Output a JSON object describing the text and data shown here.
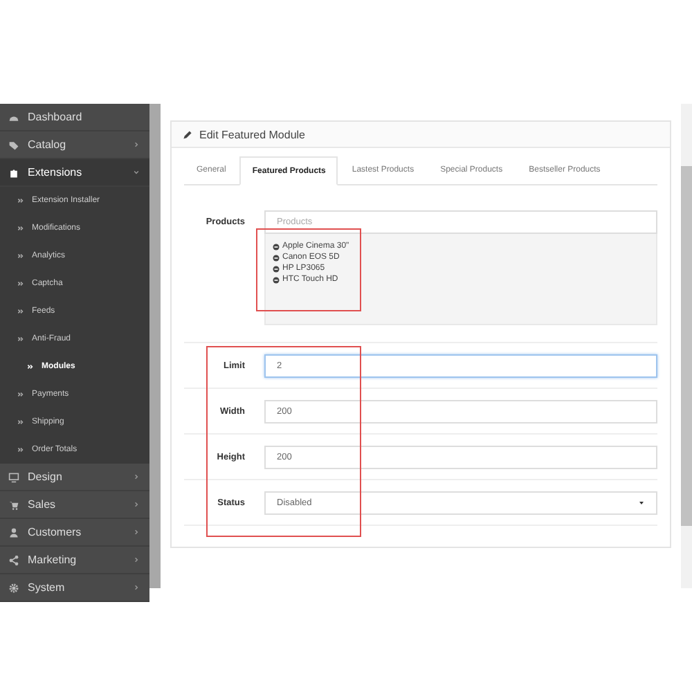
{
  "sidebar": {
    "items": [
      {
        "label": "Dashboard"
      },
      {
        "label": "Catalog",
        "expanded": false
      },
      {
        "label": "Extensions",
        "expanded": true,
        "children": [
          {
            "label": "Extension Installer",
            "selected": false
          },
          {
            "label": "Modifications",
            "selected": false
          },
          {
            "label": "Analytics",
            "selected": false
          },
          {
            "label": "Captcha",
            "selected": false
          },
          {
            "label": "Feeds",
            "selected": false
          },
          {
            "label": "Anti-Fraud",
            "selected": false
          },
          {
            "label": "Modules",
            "selected": true
          },
          {
            "label": "Payments",
            "selected": false
          },
          {
            "label": "Shipping",
            "selected": false
          },
          {
            "label": "Order Totals",
            "selected": false
          }
        ]
      },
      {
        "label": "Design",
        "expanded": false
      },
      {
        "label": "Sales",
        "expanded": false
      },
      {
        "label": "Customers",
        "expanded": false
      },
      {
        "label": "Marketing",
        "expanded": false
      },
      {
        "label": "System",
        "expanded": false
      }
    ]
  },
  "panel": {
    "title": "Edit Featured Module",
    "tabs": [
      {
        "label": "General",
        "selected": false
      },
      {
        "label": "Featured Products",
        "selected": true
      },
      {
        "label": "Lastest Products",
        "selected": false
      },
      {
        "label": "Special Products",
        "selected": false
      },
      {
        "label": "Bestseller Products",
        "selected": false
      }
    ],
    "products": {
      "label": "Products",
      "placeholder": "Products",
      "highlighted": true,
      "items": [
        "Apple Cinema 30\"",
        "Canon EOS 5D",
        "HP LP3065",
        "HTC Touch HD"
      ]
    },
    "fields_highlighted": true,
    "fields": [
      {
        "kind": "input",
        "label": "Limit",
        "value": "2",
        "focused": true
      },
      {
        "kind": "input",
        "label": "Width",
        "value": "200",
        "focused": false
      },
      {
        "kind": "input",
        "label": "Height",
        "value": "200",
        "focused": false
      },
      {
        "kind": "select",
        "label": "Status",
        "value": "Disabled",
        "focused": false
      }
    ]
  }
}
